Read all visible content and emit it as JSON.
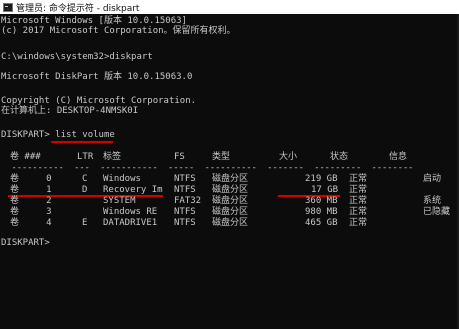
{
  "window": {
    "title": "管理员: 命令提示符 - diskpart"
  },
  "console": {
    "header_lines": [
      "Microsoft Windows [版本 10.0.15063]",
      "(c) 2017 Microsoft Corporation。保留所有权利。",
      "",
      "C:\\windows\\system32>diskpart",
      "",
      "Microsoft DiskPart 版本 10.0.15063.0",
      "",
      "Copyright (C) Microsoft Corporation.",
      "在计算机上: DESKTOP-4NMSK0I",
      "",
      "DISKPART> list volume"
    ],
    "table_headers": {
      "vol": "卷 ###",
      "ltr": "LTR",
      "label": "标签",
      "fs": "FS",
      "type": "类型",
      "size": "大小",
      "status": "状态",
      "info": "信息"
    },
    "separator": "  ----------  ---  -----------  -----  ----------  -------  ---------  --------",
    "volumes": [
      {
        "vol": "卷     0",
        "ltr": "C",
        "label": "Windows",
        "fs": "NTFS",
        "type": "磁盘分区",
        "size": "219 GB",
        "status": "正常",
        "info": "启动"
      },
      {
        "vol": "卷     1",
        "ltr": "D",
        "label": "Recovery Im",
        "fs": "NTFS",
        "type": "磁盘分区",
        "size": "17 GB",
        "status": "正常",
        "info": ""
      },
      {
        "vol": "卷     2",
        "ltr": "",
        "label": "SYSTEM",
        "fs": "FAT32",
        "type": "磁盘分区",
        "size": "360 MB",
        "status": "正常",
        "info": "系统"
      },
      {
        "vol": "卷     3",
        "ltr": "",
        "label": "Windows RE",
        "fs": "NTFS",
        "type": "磁盘分区",
        "size": "980 MB",
        "status": "正常",
        "info": "已隐藏"
      },
      {
        "vol": "卷     4",
        "ltr": "E",
        "label": "DATADRIVE1",
        "fs": "NTFS",
        "type": "磁盘分区",
        "size": "465 GB",
        "status": "正常",
        "info": ""
      }
    ],
    "prompt": "DISKPART> "
  },
  "colors": {
    "console_bg": "#0c0c0c",
    "console_fg": "#c8c8c8",
    "highlight": "#d40000"
  }
}
